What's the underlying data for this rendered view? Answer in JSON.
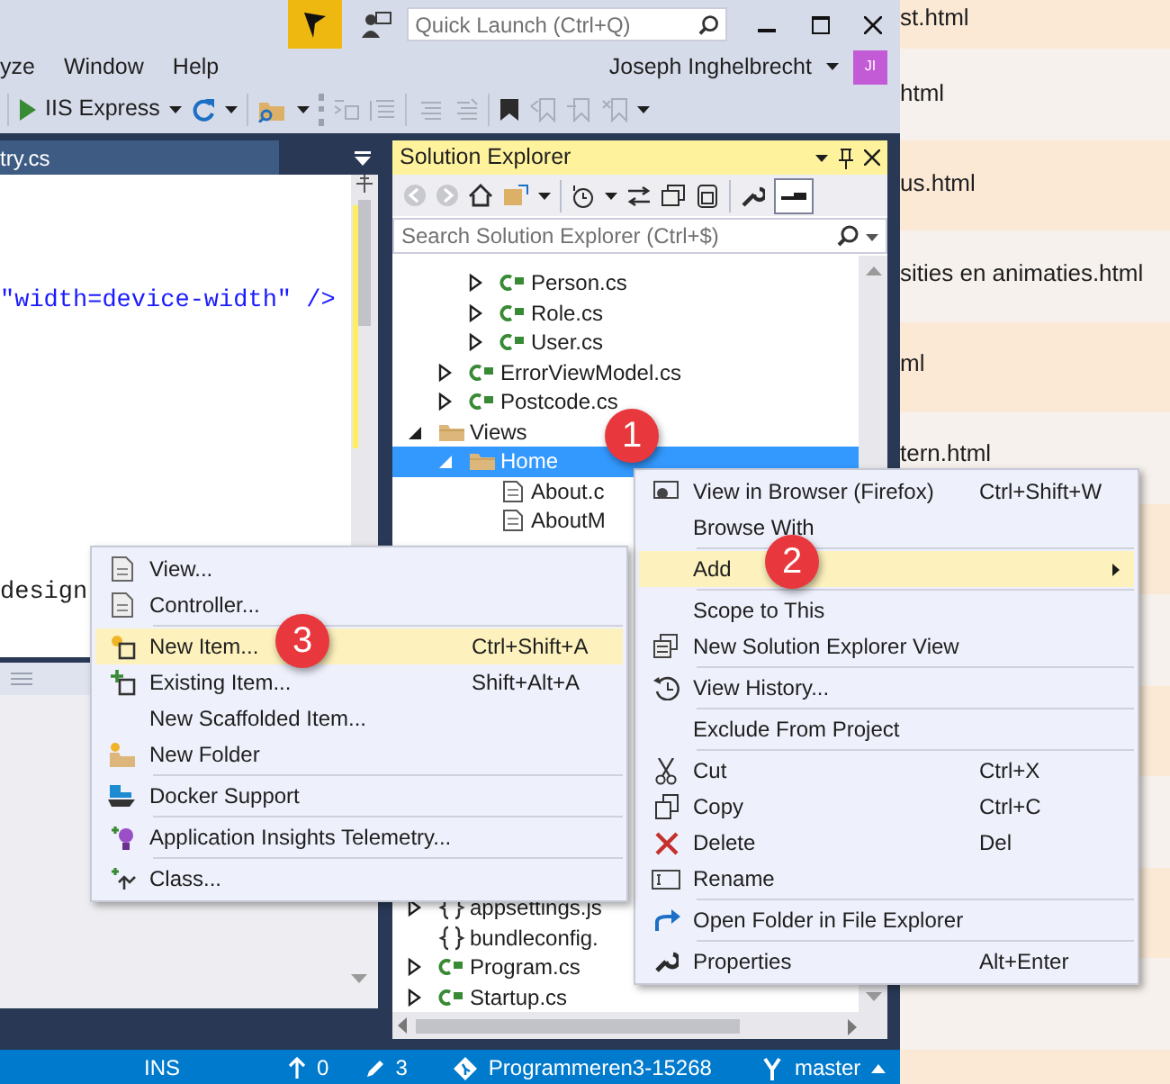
{
  "title_bar": {
    "quick_launch": {
      "placeholder": "Quick Launch (Ctrl+Q)"
    }
  },
  "menu_bar": {
    "items": [
      "yze",
      "Window",
      "Help"
    ],
    "user": "Joseph Inghelbrecht",
    "avatar": "JI"
  },
  "toolbar": {
    "run_target": "IIS Express",
    "tools": [
      {
        "disabled": false
      },
      {
        "disabled": true
      },
      {
        "disabled": true
      },
      {
        "disabled": true
      },
      {
        "disabled": true
      },
      {
        "disabled": false
      },
      {
        "disabled": true
      },
      {
        "disabled": true
      },
      {
        "disabled": true
      }
    ]
  },
  "editor": {
    "tab": "try.cs",
    "lines": [
      "\"width=device-width\" />",
      "design"
    ]
  },
  "solution_explorer": {
    "title": "Solution Explorer",
    "search": {
      "placeholder": "Search Solution Explorer (Ctrl+$)"
    },
    "tree": [
      {
        "children": [
          {
            "children": [
              {
                "label": "Person.cs",
                "kind": "cs",
                "expanded": false,
                "selected": false
              },
              {
                "label": "Role.cs",
                "kind": "cs",
                "expanded": false,
                "selected": false
              },
              {
                "label": "User.cs",
                "kind": "cs",
                "expanded": false,
                "selected": false
              }
            ]
          },
          {
            "label": "ErrorViewModel.cs",
            "kind": "cs",
            "expanded": false,
            "selected": false
          },
          {
            "label": "Postcode.cs",
            "kind": "cs",
            "expanded": false,
            "selected": false
          }
        ]
      },
      {
        "label": "Views",
        "kind": "folder",
        "expanded": true,
        "selected": false,
        "children": [
          {
            "label": "Home",
            "kind": "folder",
            "expanded": true,
            "selected": true,
            "children": [
              {
                "label": "About.c",
                "kind": "page",
                "selected": false
              },
              {
                "label": "AboutM",
                "kind": "page",
                "selected": false
              }
            ]
          }
        ]
      },
      {
        "label": "appsettings.js",
        "kind": "json",
        "expanded": false,
        "selected": false
      },
      {
        "label": "bundleconfig.",
        "kind": "json",
        "selected": false
      },
      {
        "label": "Program.cs",
        "kind": "cs",
        "expanded": false,
        "selected": false
      },
      {
        "label": "Startup.cs",
        "kind": "cs",
        "expanded": false,
        "selected": false
      }
    ]
  },
  "context_menu": {
    "items": [
      {
        "kind": "item",
        "label": "View in Browser (Firefox)",
        "shortcut": "Ctrl+Shift+W",
        "selected": false
      },
      {
        "kind": "item",
        "label": "Browse With",
        "selected": false
      },
      {
        "kind": "separator"
      },
      {
        "kind": "item",
        "label": "Add",
        "selected": true,
        "submenu": true
      },
      {
        "kind": "separator"
      },
      {
        "kind": "item",
        "label": "Scope to This",
        "selected": false
      },
      {
        "kind": "item",
        "label": "New Solution Explorer View",
        "selected": false
      },
      {
        "kind": "separator"
      },
      {
        "kind": "item",
        "label": "View History...",
        "selected": false
      },
      {
        "kind": "separator"
      },
      {
        "kind": "item",
        "label": "Exclude From Project",
        "selected": false
      },
      {
        "kind": "separator"
      },
      {
        "kind": "item",
        "label": "Cut",
        "shortcut": "Ctrl+X",
        "selected": false
      },
      {
        "kind": "item",
        "label": "Copy",
        "shortcut": "Ctrl+C",
        "selected": false
      },
      {
        "kind": "item",
        "label": "Delete",
        "shortcut": "Del",
        "selected": false
      },
      {
        "kind": "item",
        "label": "Rename",
        "selected": false
      },
      {
        "kind": "separator"
      },
      {
        "kind": "item",
        "label": "Open Folder in File Explorer",
        "selected": false
      },
      {
        "kind": "separator"
      },
      {
        "kind": "item",
        "label": "Properties",
        "shortcut": "Alt+Enter",
        "selected": false
      }
    ]
  },
  "add_submenu": {
    "items": [
      {
        "kind": "item",
        "label": "View...",
        "selected": false
      },
      {
        "kind": "item",
        "label": "Controller...",
        "selected": false
      },
      {
        "kind": "separator"
      },
      {
        "kind": "item",
        "label": "New Item...",
        "shortcut": "Ctrl+Shift+A",
        "selected": true
      },
      {
        "kind": "item",
        "label": "Existing Item...",
        "shortcut": "Shift+Alt+A",
        "selected": false
      },
      {
        "kind": "item",
        "label": "New Scaffolded Item...",
        "selected": false
      },
      {
        "kind": "item",
        "label": "New Folder",
        "selected": false
      },
      {
        "kind": "separator"
      },
      {
        "kind": "item",
        "label": "Docker Support",
        "selected": false
      },
      {
        "kind": "separator"
      },
      {
        "kind": "item",
        "label": "Application Insights Telemetry...",
        "selected": false
      },
      {
        "kind": "separator"
      },
      {
        "kind": "item",
        "label": "Class...",
        "selected": false
      }
    ]
  },
  "callouts": [
    "1",
    "2",
    "3"
  ],
  "status_bar": {
    "mode": "INS",
    "pushes": "0",
    "changes": "3",
    "repository": "Programmeren3-15268",
    "branch": "master"
  },
  "background_page": {
    "links": [
      "st.html",
      "html",
      "us.html",
      "sities en animaties.html",
      "ml",
      "tern.html"
    ]
  }
}
